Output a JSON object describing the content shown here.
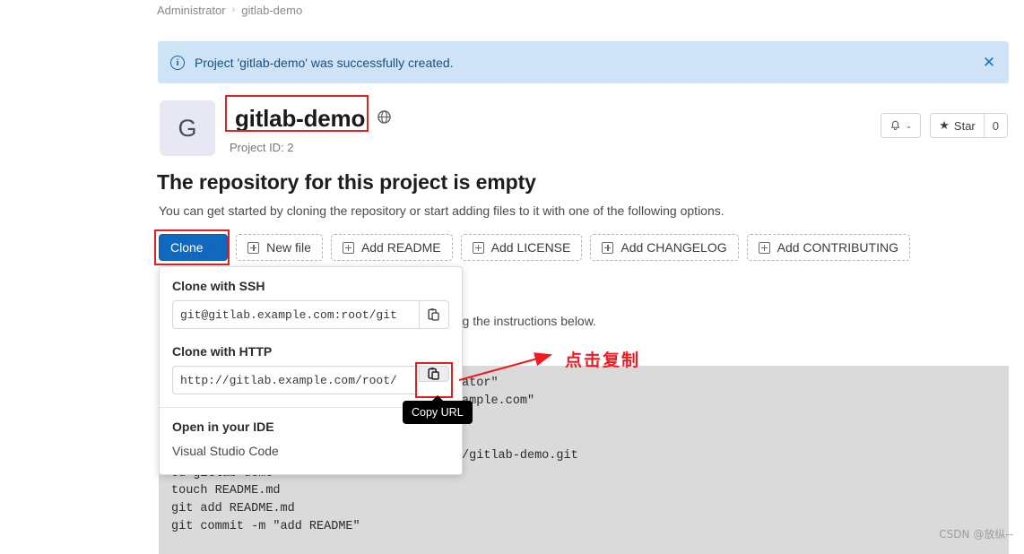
{
  "breadcrumb": {
    "root": "Administrator",
    "separator": "›",
    "current": "gitlab-demo"
  },
  "alert": {
    "icon": "info-icon",
    "message": "Project 'gitlab-demo' was successfully created.",
    "close_label": "✕"
  },
  "project": {
    "avatar_letter": "G",
    "name": "gitlab-demo",
    "visibility_icon": "globe-icon",
    "project_id_label": "Project ID: 2"
  },
  "header_actions": {
    "notification_icon": "bell-icon",
    "notification_chevron": "⌄",
    "star_icon": "★",
    "star_label": "Star",
    "star_count": "0"
  },
  "empty_state": {
    "title": "The repository for this project is empty",
    "subtitle": "You can get started by cloning the repository or start adding files to it with one of the following options."
  },
  "actions": {
    "clone_label": "Clone",
    "clone_chevron": "⌄",
    "buttons": [
      {
        "label": "New file",
        "icon": "plus-square-icon"
      },
      {
        "label": "Add README",
        "icon": "plus-square-icon"
      },
      {
        "label": "Add LICENSE",
        "icon": "plus-square-icon"
      },
      {
        "label": "Add CHANGELOG",
        "icon": "plus-square-icon"
      },
      {
        "label": "Add CONTRIBUTING",
        "icon": "plus-square-icon"
      }
    ]
  },
  "clone_menu": {
    "ssh_label": "Clone with SSH",
    "ssh_url": "git@gitlab.example.com:root/git",
    "http_label": "Clone with HTTP",
    "http_url": "http://gitlab.example.com/root/",
    "copy_icon": "clipboard-copy-icon",
    "ide_label": "Open in your IDE",
    "ide_option": "Visual Studio Code"
  },
  "tooltip": {
    "text": "Copy URL"
  },
  "behind_text": "using the instructions below.",
  "code_block": {
    "lines": [
      "git config --global user.name \"Administrator\"",
      "git config --global user.email \"admin@example.com\"",
      "git clone http://gitlab.example.com/root/gitlab-demo.git",
      "cd gitlab-demo",
      "touch README.md",
      "git add README.md",
      "git commit -m \"add README\""
    ]
  },
  "annotation": {
    "chinese_text": "点击复制",
    "color": "#ee1c22"
  },
  "watermark": {
    "text": "CSDN @放纵--"
  }
}
